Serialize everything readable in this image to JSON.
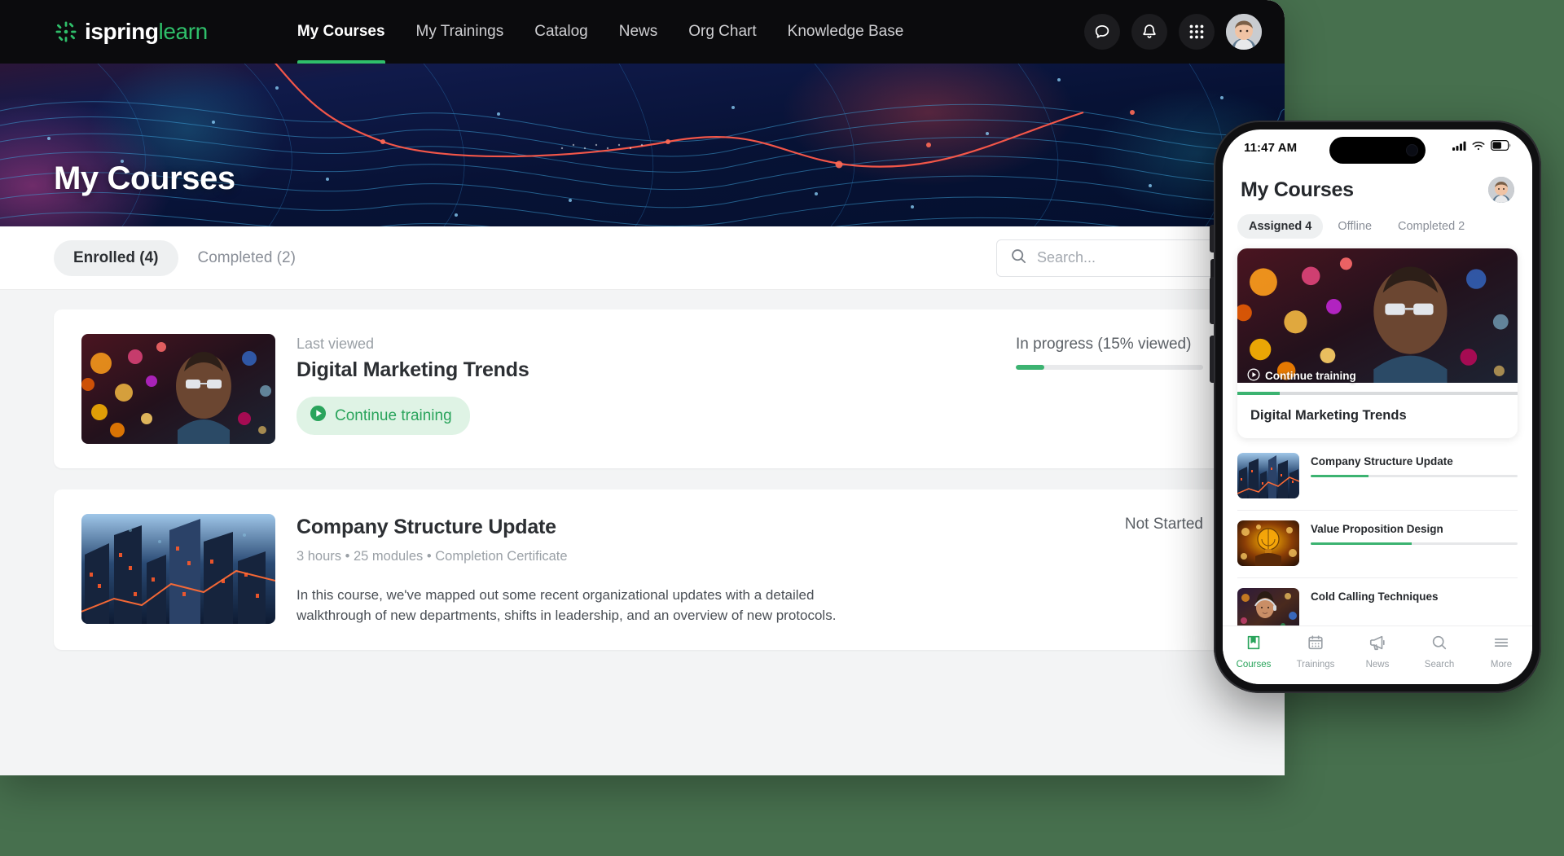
{
  "colors": {
    "page_background": "#47704e",
    "brand_green": "#2fbf6a",
    "nav_background": "#0b0b0d",
    "progress_green": "#3cb371",
    "muted_text": "#9aa0a6"
  },
  "desktop": {
    "logo": {
      "name_bold": "ispring",
      "name_light": "learn",
      "icon": "ispring-burst-icon"
    },
    "nav": {
      "items": [
        {
          "label": "My Courses",
          "active": true
        },
        {
          "label": "My Trainings",
          "active": false
        },
        {
          "label": "Catalog",
          "active": false
        },
        {
          "label": "News",
          "active": false
        },
        {
          "label": "Org Chart",
          "active": false
        },
        {
          "label": "Knowledge Base",
          "active": false
        }
      ],
      "actions": [
        {
          "icon": "chat-bubble-icon",
          "label": "Messages"
        },
        {
          "icon": "bell-icon",
          "label": "Notifications"
        },
        {
          "icon": "apps-grid-icon",
          "label": "Apps"
        }
      ],
      "avatar_alt": "User avatar"
    },
    "hero": {
      "title": "My Courses"
    },
    "tabs": [
      {
        "label": "Enrolled (4)",
        "active": true
      },
      {
        "label": "Completed (2)",
        "active": false
      }
    ],
    "search": {
      "placeholder": "Search...",
      "value": "",
      "icon": "search-icon"
    },
    "courses": [
      {
        "eyebrow": "Last viewed",
        "title": "Digital Marketing Trends",
        "cta": "Continue training",
        "cta_icon": "play-circle-icon",
        "status": "In progress (15% viewed)",
        "progress_percent": 15,
        "thumb": "digital-marketing-bokeh-thumbnail"
      },
      {
        "eyebrow": "",
        "title": "Company Structure Update",
        "meta": "3 hours • 25 modules  •  Completion Certificate",
        "description": "In this course, we've mapped out some recent organizational updates with a detailed walkthrough of new departments, shifts in leadership, and an overview of new protocols.",
        "status": "Not Started",
        "progress_percent": 0,
        "thumb": "city-skyscrapers-thumbnail"
      }
    ]
  },
  "phone": {
    "status_bar": {
      "time": "11:47 AM",
      "cellular": "signal-bars-icon",
      "wifi": "wifi-icon",
      "battery": "battery-icon"
    },
    "header": {
      "title": "My Courses",
      "avatar_alt": "User avatar"
    },
    "tabs": [
      {
        "label": "Assigned 4",
        "active": true
      },
      {
        "label": "Offline",
        "active": false
      },
      {
        "label": "Completed 2",
        "active": false
      }
    ],
    "featured": {
      "cta": "Continue training",
      "cta_icon": "play-circle-icon",
      "title": "Digital Marketing Trends",
      "progress_percent": 15,
      "thumb": "digital-marketing-bokeh-thumbnail"
    },
    "list": [
      {
        "title": "Company Structure Update",
        "progress_percent": 28,
        "thumb": "city-skyscrapers-thumbnail"
      },
      {
        "title": "Value Proposition Design",
        "progress_percent": 49,
        "thumb": "lightbulb-globe-thumbnail"
      },
      {
        "title": "Cold Calling Techniques",
        "progress_percent": 0,
        "thumb": "call-center-agent-thumbnail"
      }
    ],
    "tabbar": [
      {
        "label": "Courses",
        "icon": "book-icon",
        "active": true
      },
      {
        "label": "Trainings",
        "icon": "calendar-icon",
        "active": false
      },
      {
        "label": "News",
        "icon": "megaphone-icon",
        "active": false
      },
      {
        "label": "Search",
        "icon": "search-icon",
        "active": false
      },
      {
        "label": "More",
        "icon": "hamburger-icon",
        "active": false
      }
    ]
  }
}
